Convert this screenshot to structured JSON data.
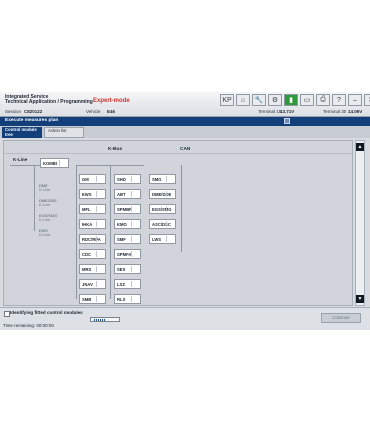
{
  "app": {
    "title_line_1": "Integrated Service",
    "title_line_2": "Technical Application / Programming",
    "mode": "Expert-mode",
    "session_label": "Session",
    "session_value": "C820122",
    "vehicle_label": "Vehicle",
    "vehicle_value": "E46",
    "terminal15_label": "Terminal 15",
    "terminal15_value": "13.71V",
    "terminal30_label": "Terminal 30",
    "terminal30_value": "14.06V"
  },
  "toolbar": {
    "icons": [
      "ap-icon",
      "home-icon",
      "wrench-icon",
      "tool-icon",
      "battery-icon",
      "car-icon",
      "printer-icon",
      "help-icon",
      "minimize-icon",
      "close-icon"
    ],
    "labels": [
      "KP",
      "⌂",
      "🔧",
      "⚙",
      "▮",
      "▭",
      "⎙",
      "?",
      "–",
      "✕"
    ]
  },
  "section_bar": {
    "title": "Execute measures plan"
  },
  "tabs": [
    {
      "label": "Control module tree"
    },
    {
      "label": "Action list"
    }
  ],
  "canvas": {
    "header_left": "K-Bus",
    "header_right": "CAN",
    "kline_label": "K-Line",
    "kombi": "KOMBI",
    "left_labels": [
      {
        "title": "DME",
        "sub": "K-Line"
      },
      {
        "title": "DME/DDE",
        "sub": "K-Line"
      },
      {
        "title": "EGS/SMG",
        "sub": "K-Line"
      },
      {
        "title": "EWS",
        "sub": "K-Line"
      }
    ],
    "columns": {
      "col1": [
        "GM",
        "EWS",
        "MFL",
        "IHKA",
        "RDC/RPA",
        "CDC",
        "MRS",
        "JNAV",
        "SMB"
      ],
      "col2": [
        "SHD",
        "ABT",
        "SPMBF",
        "KMO",
        "SMF",
        "SPMFA",
        "SES",
        "LSZ",
        "RLS"
      ],
      "col3": [
        "SMG",
        "DME/DDE",
        "EGS/SMG",
        "ASC/DSC",
        "LWS"
      ]
    }
  },
  "status": {
    "checkbox_label": "Identifying fitted control modules",
    "progress": 0.45,
    "time_remaining": "Time remaining: 00:00:00",
    "continue_label": "Continue"
  },
  "colors": {
    "accent": "#123f7a",
    "mode": "#d0342c",
    "active_icon": "#2f9a3a"
  }
}
